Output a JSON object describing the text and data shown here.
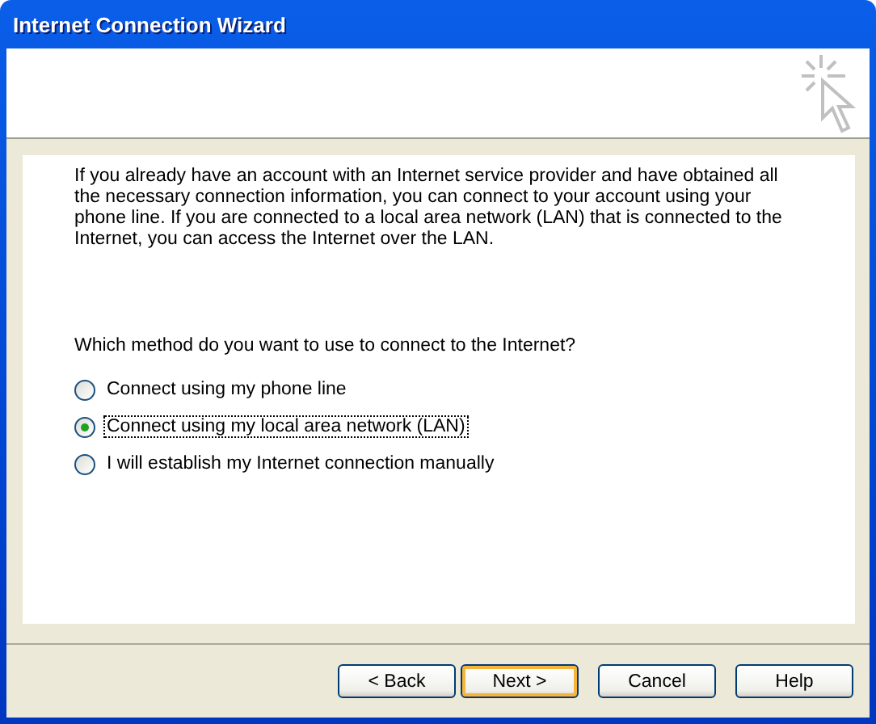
{
  "window": {
    "title": "Internet Connection Wizard"
  },
  "intro": "If you already have an account with an Internet service provider and have obtained all the necessary connection information, you can connect to your account using your phone line. If you are connected to a local area network (LAN) that is connected to the Internet, you can access the Internet over the LAN.",
  "question": "Which method do you want to use to connect to the Internet?",
  "options": [
    {
      "label": "Connect using my phone line",
      "selected": false,
      "focused": false
    },
    {
      "label": "Connect using my local area network (LAN)",
      "selected": true,
      "focused": true
    },
    {
      "label": "I will establish my Internet connection manually",
      "selected": false,
      "focused": false
    }
  ],
  "buttons": [
    {
      "label": "< Back",
      "default": false
    },
    {
      "label": "Next >",
      "default": true
    },
    {
      "label": "Cancel",
      "default": false
    },
    {
      "label": "Help",
      "default": false
    }
  ]
}
